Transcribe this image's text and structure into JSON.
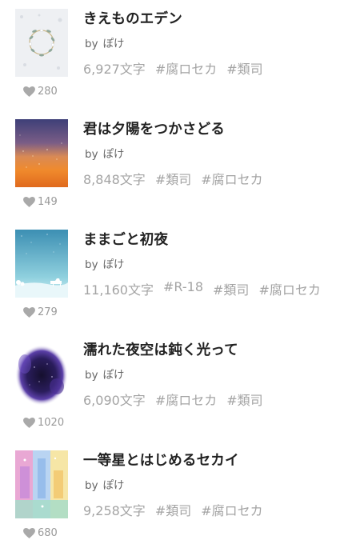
{
  "works": [
    {
      "title": "きえものエデン",
      "by": "by",
      "author": "ぽけ",
      "chars": "6,927文字",
      "tags": [
        "#腐ロセカ",
        "#類司"
      ],
      "likes": "280",
      "cover": "wreath"
    },
    {
      "title": "君は夕陽をつかさどる",
      "by": "by",
      "author": "ぽけ",
      "chars": "8,848文字",
      "tags": [
        "#類司",
        "#腐ロセカ"
      ],
      "likes": "149",
      "cover": "sunset"
    },
    {
      "title": "ままごと初夜",
      "by": "by",
      "author": "ぽけ",
      "chars": "11,160文字",
      "tags": [
        "#R-18",
        "#類司",
        "#腐ロセカ"
      ],
      "likes": "279",
      "cover": "snowfield"
    },
    {
      "title": "濡れた夜空は鈍く光って",
      "by": "by",
      "author": "ぽけ",
      "chars": "6,090文字",
      "tags": [
        "#腐ロセカ",
        "#類司"
      ],
      "likes": "1020",
      "cover": "nebula"
    },
    {
      "title": "一等星とはじめるセカイ",
      "by": "by",
      "author": "ぽけ",
      "chars": "9,258文字",
      "tags": [
        "#類司",
        "#腐ロセカ"
      ],
      "likes": "680",
      "cover": "colorful"
    }
  ],
  "colors": {
    "title": "#222222",
    "meta": "#a4a4a4",
    "heart": "#a9a9a9"
  },
  "icons": {
    "like": "heart-icon"
  }
}
